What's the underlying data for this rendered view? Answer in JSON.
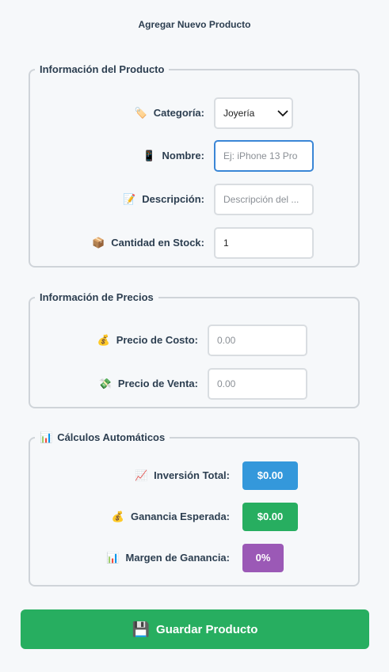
{
  "form": {
    "title": "Agregar Nuevo Producto"
  },
  "product_info": {
    "legend": "Información del Producto",
    "category": {
      "icon": "🏷️",
      "label": "Categoría:",
      "value": "Joyería"
    },
    "name": {
      "icon": "📱",
      "label": "Nombre:",
      "value": "",
      "placeholder": "Ej: iPhone 13 Pro"
    },
    "description": {
      "icon": "📝",
      "label": "Descripción:",
      "value": "",
      "placeholder": "Descripción del ..."
    },
    "stock": {
      "icon": "📦",
      "label": "Cantidad en Stock:",
      "value": "1"
    }
  },
  "pricing": {
    "legend": "Información de Precios",
    "cost": {
      "icon": "💰",
      "label": "Precio de Costo:",
      "placeholder": "0.00"
    },
    "sale": {
      "icon": "💸",
      "label": "Precio de Venta:",
      "placeholder": "0.00"
    }
  },
  "calculations": {
    "icon": "📊",
    "legend": "Cálculos Automáticos",
    "investment": {
      "icon": "📈",
      "label": "Inversión Total:",
      "value": "$0.00",
      "color": "#3498db"
    },
    "profit": {
      "icon": "💰",
      "label": "Ganancia Esperada:",
      "value": "$0.00",
      "color": "#27ae60"
    },
    "margin": {
      "icon": "📊",
      "label": "Margen de Ganancia:",
      "value": "0%",
      "color": "#9b59b6"
    }
  },
  "actions": {
    "save_icon": "💾",
    "save_label": "Guardar Producto"
  }
}
